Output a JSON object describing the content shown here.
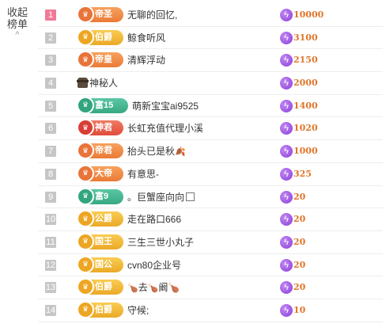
{
  "collapse": {
    "line1": "收起",
    "line2": "榜单",
    "chevron": "^"
  },
  "rows": [
    {
      "rank": "1",
      "badge": "帝圣",
      "badge_color": "orange",
      "name": "无聊的回忆,",
      "score": "10000",
      "top": true
    },
    {
      "rank": "2",
      "badge": "伯爵",
      "badge_color": "gold",
      "name": "鲸食听风",
      "score": "3100"
    },
    {
      "rank": "3",
      "badge": "帝皇",
      "badge_color": "orange",
      "name": "清辉浮动",
      "score": "2150"
    },
    {
      "rank": "4",
      "badge": "",
      "badge_color": "",
      "name": "神秘人",
      "score": "2000",
      "icon": "mystery-agent-icon"
    },
    {
      "rank": "5",
      "badge": "富15",
      "badge_color": "teal",
      "name": "萌新宝宝ai9525",
      "score": "1400"
    },
    {
      "rank": "6",
      "badge": "神君",
      "badge_color": "red",
      "name": "长虹充值代理小溪",
      "score": "1020"
    },
    {
      "rank": "7",
      "badge": "帝君",
      "badge_color": "orange",
      "name": "抬头已是秋",
      "score": "1000",
      "suffix_icon": "fallen-leaf-icon"
    },
    {
      "rank": "8",
      "badge": "大帝",
      "badge_color": "orange",
      "name": "有意思-",
      "score": "325"
    },
    {
      "rank": "9",
      "badge": "富9",
      "badge_color": "teal",
      "name": "。巨蟹座向向",
      "score": "20",
      "suffix_icon": "box-icon"
    },
    {
      "rank": "10",
      "badge": "公爵",
      "badge_color": "gold",
      "name": "走在路口666",
      "score": "20"
    },
    {
      "rank": "11",
      "badge": "国王",
      "badge_color": "gold",
      "name": "三生三世小丸子",
      "score": "20"
    },
    {
      "rank": "12",
      "badge": "国公",
      "badge_color": "gold",
      "name": "cvn80企业号",
      "score": "20"
    },
    {
      "rank": "13",
      "badge": "伯爵",
      "badge_color": "gold",
      "name": "去",
      "score": "20",
      "name_pre": "🍗",
      "name_mid": "🍗",
      "name_post": "阚🍗"
    },
    {
      "rank": "14",
      "badge": "伯爵",
      "badge_color": "gold",
      "name": "守候;",
      "score": "10"
    }
  ],
  "colors": {
    "rank_top": "#f07a98",
    "rank_other": "#c6c6c6",
    "score_text": "#e0752a",
    "bolt": "#8a3ed6"
  },
  "icons": {
    "score": "lightning-bolt-icon",
    "collapse": "chevron-up-icon"
  }
}
